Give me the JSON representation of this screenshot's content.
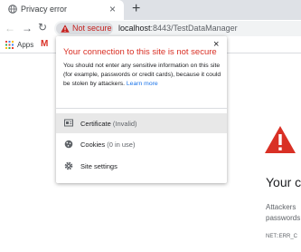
{
  "tab": {
    "title": "Privacy error",
    "close_icon": "close-icon",
    "newtab_icon": "plus-icon"
  },
  "toolbar": {
    "security_chip": "Not secure",
    "url_host": "localhost",
    "url_rest": ":8443/TestDataManager"
  },
  "bookmarks": {
    "apps_label": "Apps",
    "gmail_letter": "M"
  },
  "page": {
    "heading": "Your c",
    "text_line1": "Attackers",
    "text_line2": "passwords",
    "error_code": "NET::ERR_C"
  },
  "popup": {
    "title": "Your connection to this site is not secure",
    "description": "You should not enter any sensitive information on this site (for example, passwords or credit cards), because it could be stolen by attackers.",
    "learn_more": "Learn more",
    "certificate_label": "Certificate",
    "certificate_status": "(Invalid)",
    "cookies_label": "Cookies",
    "cookies_status": "(0 in use)",
    "site_settings_label": "Site settings"
  },
  "colors": {
    "danger": "#d93025",
    "link": "#1a73e8",
    "accent": "#1a73e8"
  }
}
